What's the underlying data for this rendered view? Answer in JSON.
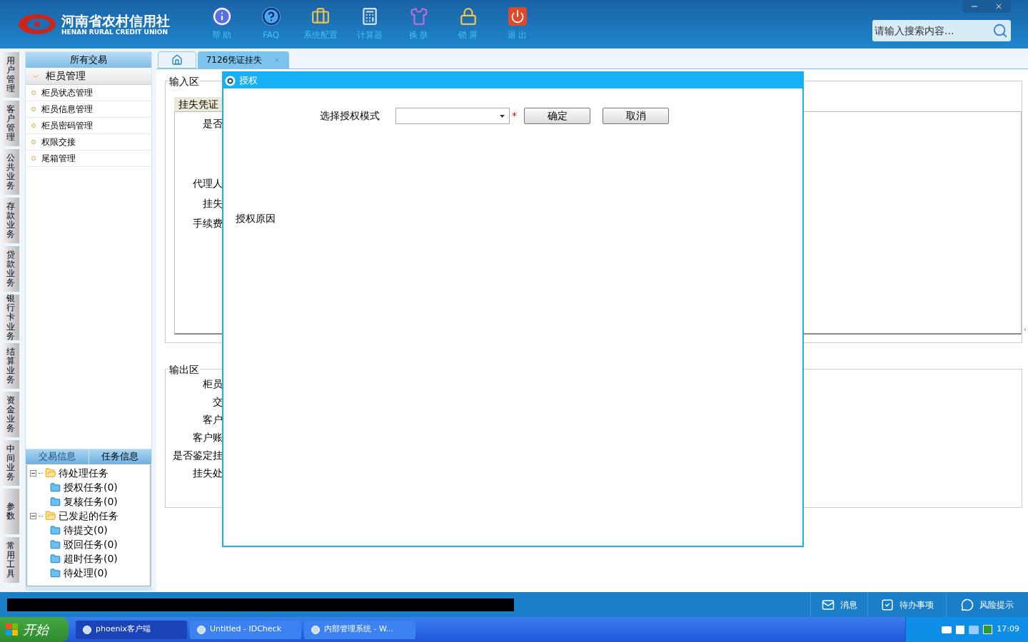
{
  "header": {
    "logo_title": "河南省农村信用社",
    "logo_subtitle": "HENAN RURAL CREDIT UNION",
    "toolbar": [
      {
        "kind": "info",
        "label": "帮 助"
      },
      {
        "kind": "help",
        "label": "FAQ"
      },
      {
        "kind": "toolbox",
        "label": "系统配置"
      },
      {
        "kind": "calculator",
        "label": "计算器"
      },
      {
        "kind": "shirt",
        "label": "换 肤"
      },
      {
        "kind": "lock",
        "label": "锁 屏"
      },
      {
        "kind": "power",
        "label": "退 出"
      }
    ],
    "search": {
      "placeholder": "请输入搜索内容..."
    }
  },
  "side_tabs": [
    {
      "label": "用户管理"
    },
    {
      "label": "客户管理"
    },
    {
      "label": "公共业务"
    },
    {
      "label": "存款业务"
    },
    {
      "label": "贷款业务"
    },
    {
      "label": "银行卡业务"
    },
    {
      "label": "结算业务"
    },
    {
      "label": "资金业务"
    },
    {
      "label": "中间业务"
    },
    {
      "label": "参数"
    },
    {
      "label": "常用工具"
    }
  ],
  "sidebar": {
    "title": "所有交易",
    "group": {
      "label": "柜员管理",
      "expanded": true,
      "items": [
        {
          "label": "柜员状态管理"
        },
        {
          "label": "柜员信息管理"
        },
        {
          "label": "柜员密码管理"
        },
        {
          "label": "权限交接"
        },
        {
          "label": "尾箱管理"
        }
      ]
    }
  },
  "task_panel": {
    "tabs": [
      {
        "label": "交易信息",
        "selected": false
      },
      {
        "label": "任务信息",
        "selected": true
      }
    ],
    "tree": [
      {
        "label": "待处理任务",
        "expanded": true,
        "children": [
          {
            "label": "授权任务(0)"
          },
          {
            "label": "复核任务(0)"
          }
        ]
      },
      {
        "label": "已发起的任务",
        "expanded": true,
        "children": [
          {
            "label": "待提交(0)"
          },
          {
            "label": "驳回任务(0)"
          },
          {
            "label": "超时任务(0)"
          },
          {
            "label": "待处理(0)"
          }
        ]
      }
    ]
  },
  "main": {
    "tabs": [
      {
        "kind": "home",
        "selected": false
      },
      {
        "kind": "text",
        "label": "7126凭证挂失",
        "selected": true
      }
    ],
    "input_area": {
      "legend": "输入区",
      "tab": "挂失凭证",
      "labels": [
        "是否",
        "代理人",
        "挂失",
        "手续费"
      ]
    },
    "output_area": {
      "legend": "输出区",
      "labels": [
        "柜员",
        "交",
        "客户",
        "客户账",
        "是否鉴定挂",
        "挂失处"
      ]
    }
  },
  "dialog": {
    "title": "授权",
    "mode_label": "选择授权模式",
    "required_mark": "*",
    "buttons": [
      "确定",
      "取消"
    ],
    "reason_label": "授权原因"
  },
  "status_bar": {
    "items": [
      {
        "kind": "mail",
        "label": "消息"
      },
      {
        "kind": "check",
        "label": "待办事项"
      },
      {
        "kind": "chat",
        "label": "风险提示"
      }
    ]
  },
  "taskbar": {
    "start": "开始",
    "items": [
      {
        "label": "phoenix客户端",
        "selected": true
      },
      {
        "label": "Untitled - IDCheck",
        "selected": false
      },
      {
        "label": "内部管理系统 - W...",
        "selected": false
      }
    ],
    "clock": "17:09"
  }
}
